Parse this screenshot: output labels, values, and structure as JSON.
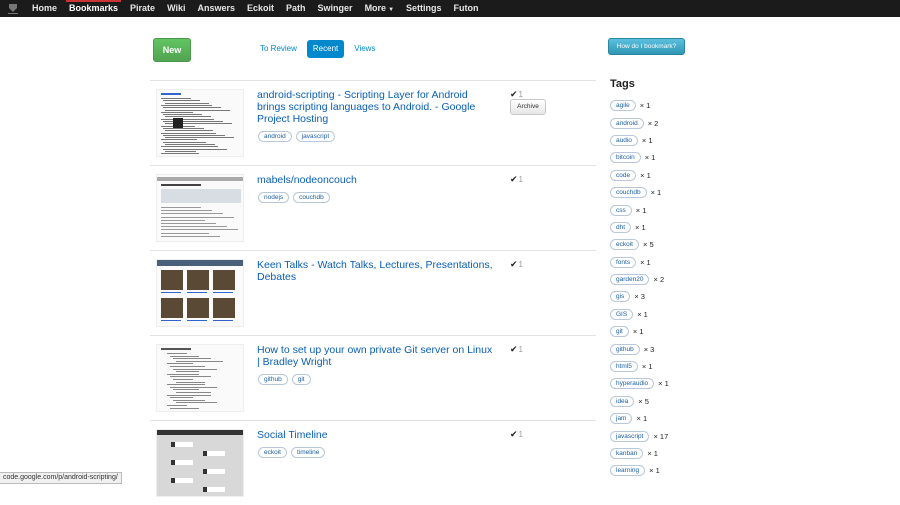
{
  "nav": {
    "items": [
      {
        "label": "Home"
      },
      {
        "label": "Bookmarks",
        "active": true
      },
      {
        "label": "Pirate"
      },
      {
        "label": "Wiki"
      },
      {
        "label": "Answers"
      },
      {
        "label": "Eckoit"
      },
      {
        "label": "Path"
      },
      {
        "label": "Swinger"
      },
      {
        "label": "More",
        "caret": "▼"
      },
      {
        "label": "Settings"
      },
      {
        "label": "Futon"
      }
    ]
  },
  "toolbar": {
    "new_label": "New",
    "tabs": [
      {
        "label": "To Review"
      },
      {
        "label": "Recent",
        "active": true
      },
      {
        "label": "Views"
      }
    ],
    "help_label": "How do I bookmark?"
  },
  "bookmarks": [
    {
      "title": "android-scripting - Scripting Layer for Android brings scripting languages to Android. - Google Project Hosting",
      "tags": [
        "android",
        "javascript"
      ],
      "count": "1",
      "archive_label": "Archive",
      "thumb": "doc"
    },
    {
      "title": "mabels/nodeoncouch",
      "tags": [
        "nodejs",
        "couchdb"
      ],
      "count": "1",
      "thumb": "github"
    },
    {
      "title": "Keen Talks - Watch Talks, Lectures, Presentations, Debates",
      "tags": [],
      "count": "1",
      "thumb": "photos"
    },
    {
      "title": "How to set up your own private Git server on Linux | Bradley Wright",
      "tags": [
        "github",
        "git"
      ],
      "count": "1",
      "thumb": "text"
    },
    {
      "title": "Social Timeline",
      "tags": [
        "eckoit",
        "timeline"
      ],
      "count": "1",
      "thumb": "dark"
    }
  ],
  "sidebar": {
    "title": "Tags",
    "tags": [
      {
        "name": "agile",
        "count": "× 1"
      },
      {
        "name": "android",
        "count": "× 2"
      },
      {
        "name": "audio",
        "count": "× 1"
      },
      {
        "name": "bitcoin",
        "count": "× 1"
      },
      {
        "name": "code",
        "count": "× 1"
      },
      {
        "name": "couchdb",
        "count": "× 1"
      },
      {
        "name": "css",
        "count": "× 1"
      },
      {
        "name": "dht",
        "count": "× 1"
      },
      {
        "name": "eckoit",
        "count": "× 5"
      },
      {
        "name": "fonts",
        "count": "× 1"
      },
      {
        "name": "garden20",
        "count": "× 2"
      },
      {
        "name": "gis",
        "count": "× 3"
      },
      {
        "name": "GIS",
        "count": "× 1"
      },
      {
        "name": "git",
        "count": "× 1"
      },
      {
        "name": "github",
        "count": "× 3"
      },
      {
        "name": "html5",
        "count": "× 1"
      },
      {
        "name": "hyperaudio",
        "count": "× 1"
      },
      {
        "name": "idea",
        "count": "× 5"
      },
      {
        "name": "jam",
        "count": "× 1"
      },
      {
        "name": "javascript",
        "count": "× 17"
      },
      {
        "name": "kanban",
        "count": "× 1"
      },
      {
        "name": "learning",
        "count": "× 1"
      }
    ]
  },
  "status_url": "code.google.com/p/android-scripting/",
  "colors": {
    "link": "#0a5fb4",
    "new_button": "#5eb95e",
    "tab_active": "#0088cc",
    "help_button": "#49afcd",
    "topbar": "#1b1b1b"
  }
}
